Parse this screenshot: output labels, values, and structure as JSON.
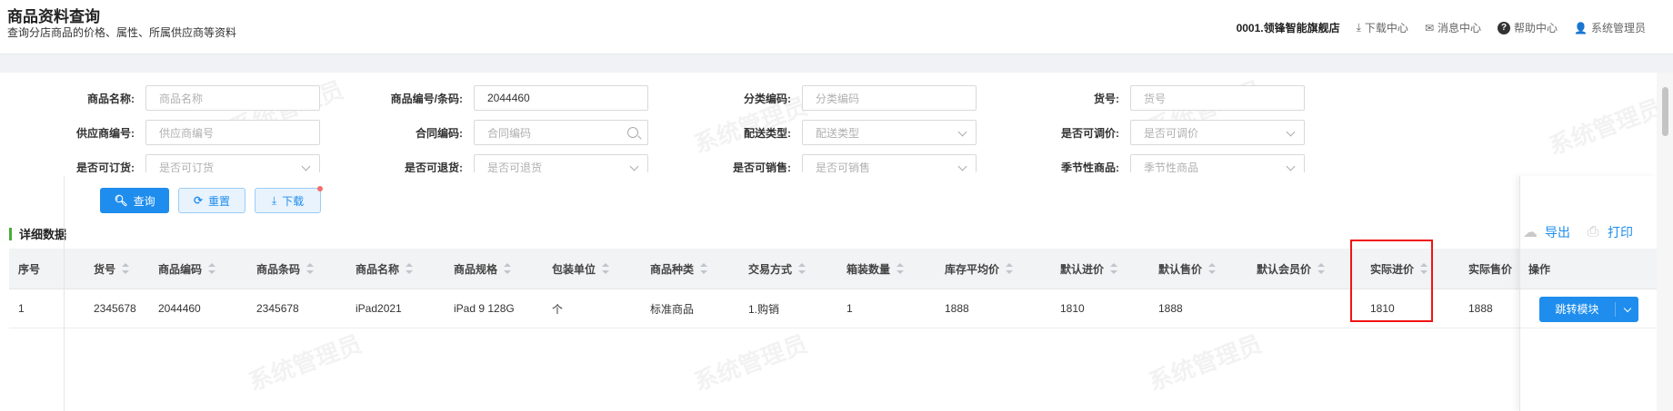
{
  "header": {
    "title": "商品资料查询",
    "subtitle": "查询分店商品的价格、属性、所属供应商等资料",
    "store": "0001.领锋智能旗舰店",
    "links": [
      "下载中心",
      "消息中心",
      "帮助中心",
      "系统管理员"
    ]
  },
  "filters": {
    "product_name": {
      "label": "商品名称:",
      "placeholder": "商品名称",
      "value": ""
    },
    "product_code": {
      "label": "商品编号/条码:",
      "placeholder": "",
      "value": "2044460"
    },
    "category_code": {
      "label": "分类编码:",
      "placeholder": "分类编码",
      "value": ""
    },
    "item_no": {
      "label": "货号:",
      "placeholder": "货号",
      "value": ""
    },
    "supplier_code": {
      "label": "供应商编号:",
      "placeholder": "供应商编号",
      "value": ""
    },
    "contract_code": {
      "label": "合同编码:",
      "placeholder": "合同编码",
      "value": ""
    },
    "delivery_type": {
      "label": "配送类型:",
      "placeholder": "配送类型",
      "value": ""
    },
    "price_adjustable": {
      "label": "是否可调价:",
      "placeholder": "是否可调价",
      "value": ""
    },
    "orderable": {
      "label": "是否可订货:",
      "placeholder": "是否可订货",
      "value": ""
    },
    "returnable": {
      "label": "是否可退货:",
      "placeholder": "是否可退货",
      "value": ""
    },
    "sellable": {
      "label": "是否可销售:",
      "placeholder": "是否可销售",
      "value": ""
    },
    "seasonal": {
      "label": "季节性商品:",
      "placeholder": "季节性商品",
      "value": ""
    }
  },
  "buttons": {
    "query": "查询",
    "reset": "重置",
    "download": "下载"
  },
  "section": {
    "title": "详细数据",
    "export": "导出",
    "print": "打印"
  },
  "table": {
    "columns": [
      "序号",
      "货号",
      "商品编码",
      "商品条码",
      "商品名称",
      "商品规格",
      "包装单位",
      "商品种类",
      "交易方式",
      "箱装数量",
      "库存平均价",
      "默认进价",
      "默认售价",
      "默认会员价",
      "实际进价",
      "实际售价",
      "操作"
    ],
    "rows": [
      [
        "1",
        "2345678",
        "2044460",
        "2345678",
        "iPad2021",
        "iPad 9 128G",
        "个",
        "标准商品",
        "1.购销",
        "1",
        "1888",
        "1810",
        "1888",
        "",
        "1810",
        "1888"
      ]
    ],
    "action_label": "跳转模块"
  },
  "watermark": "系统管理员",
  "colors": {
    "primary": "#1e8ded",
    "highlight": "#f01414",
    "accent_bar": "#46b035"
  }
}
